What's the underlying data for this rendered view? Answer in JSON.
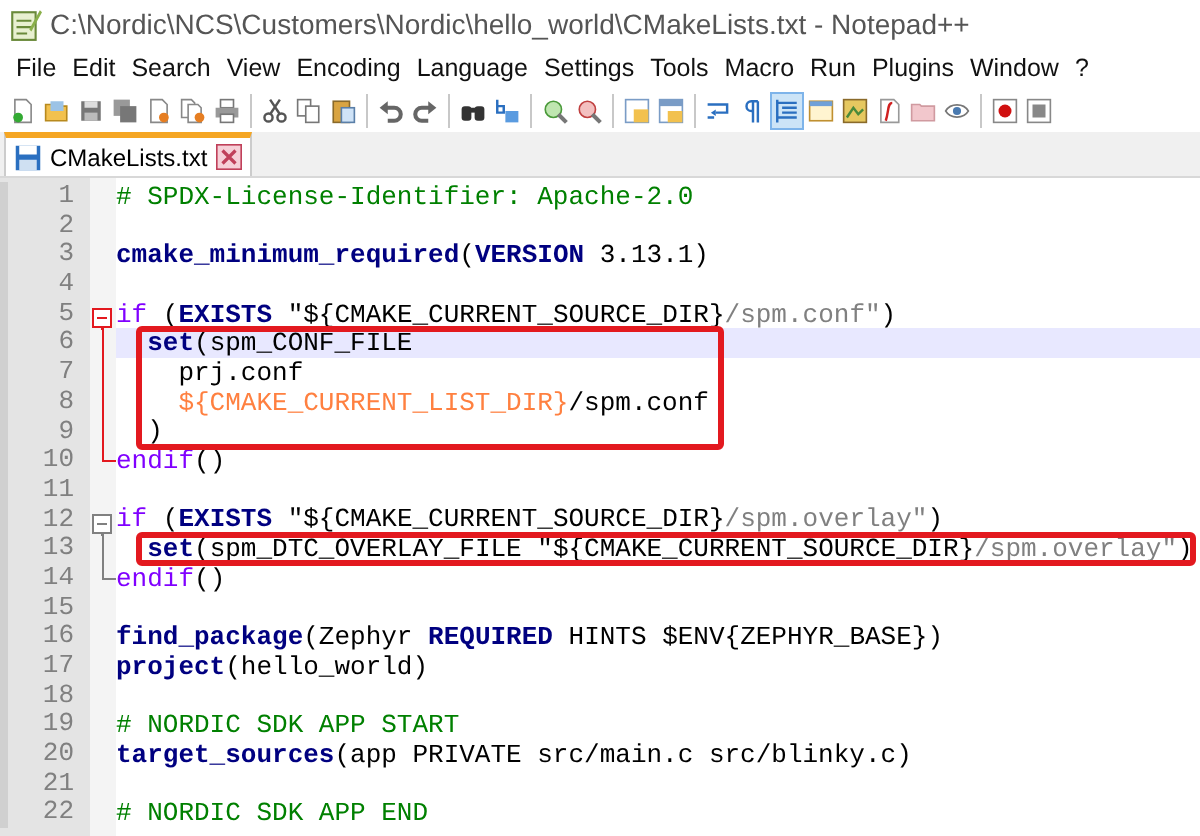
{
  "window": {
    "title": "C:\\Nordic\\NCS\\Customers\\Nordic\\hello_world\\CMakeLists.txt - Notepad++"
  },
  "menu": [
    "File",
    "Edit",
    "Search",
    "View",
    "Encoding",
    "Language",
    "Settings",
    "Tools",
    "Macro",
    "Run",
    "Plugins",
    "Window",
    "?"
  ],
  "toolbar": [
    {
      "kind": "new",
      "pressed": false
    },
    {
      "kind": "open",
      "pressed": false
    },
    {
      "kind": "save",
      "pressed": false
    },
    {
      "kind": "saveall",
      "pressed": false
    },
    {
      "kind": "close",
      "pressed": false
    },
    {
      "kind": "closeall",
      "pressed": false
    },
    {
      "kind": "print",
      "pressed": false
    },
    {
      "kind": "separator"
    },
    {
      "kind": "cut",
      "pressed": false
    },
    {
      "kind": "copy",
      "pressed": false
    },
    {
      "kind": "paste",
      "pressed": false
    },
    {
      "kind": "separator"
    },
    {
      "kind": "undo",
      "pressed": false
    },
    {
      "kind": "redo",
      "pressed": false
    },
    {
      "kind": "separator"
    },
    {
      "kind": "find",
      "pressed": false
    },
    {
      "kind": "replace",
      "pressed": false
    },
    {
      "kind": "separator"
    },
    {
      "kind": "zoomin",
      "pressed": false
    },
    {
      "kind": "zoomout",
      "pressed": false
    },
    {
      "kind": "separator"
    },
    {
      "kind": "syncv",
      "pressed": false
    },
    {
      "kind": "synch",
      "pressed": false
    },
    {
      "kind": "separator"
    },
    {
      "kind": "wrap",
      "pressed": false
    },
    {
      "kind": "allchars",
      "pressed": false
    },
    {
      "kind": "indent",
      "pressed": true
    },
    {
      "kind": "udl",
      "pressed": false
    },
    {
      "kind": "docmap",
      "pressed": false
    },
    {
      "kind": "funclist",
      "pressed": false
    },
    {
      "kind": "workspace",
      "pressed": false
    },
    {
      "kind": "monitor",
      "pressed": false
    },
    {
      "kind": "separator"
    },
    {
      "kind": "record",
      "pressed": false
    },
    {
      "kind": "stop",
      "pressed": false
    }
  ],
  "tabs": [
    {
      "label": "CMakeLists.txt",
      "selected": true,
      "modified": false
    }
  ],
  "lines": [
    {
      "number": "1",
      "current": false,
      "boxed": false,
      "tokens": [
        {
          "kind": "comment",
          "text": "# SPDX-License-Identifier: Apache-2.0"
        }
      ]
    },
    {
      "number": "2",
      "current": false,
      "boxed": false
    },
    {
      "number": "3",
      "current": false,
      "boxed": false,
      "tokens": [
        {
          "kind": "func",
          "text": "cmake_minimum_required"
        },
        {
          "kind": "plain",
          "text": "("
        },
        {
          "kind": "kw",
          "text": "VERSION"
        },
        {
          "kind": "plain",
          "text": " 3.13.1)"
        }
      ]
    },
    {
      "number": "4",
      "current": false,
      "boxed": false
    },
    {
      "number": "5",
      "current": false,
      "boxed": false,
      "fold_head": true,
      "fold_tail": false,
      "fold_active": true,
      "tokens": [
        {
          "kind": "ctrl",
          "text": "if"
        },
        {
          "kind": "plain",
          "text": " ("
        },
        {
          "kind": "kw",
          "text": "EXISTS"
        },
        {
          "kind": "plain",
          "text": " \"${CMAKE_CURRENT_SOURCE_DIR}"
        },
        {
          "kind": "str",
          "text": "/spm.conf\""
        },
        {
          "kind": "plain",
          "text": ")"
        }
      ]
    },
    {
      "number": "6",
      "current": true,
      "boxed": true,
      "fold_head": false,
      "fold_tail": false,
      "fold_active": true,
      "tokens": [
        {
          "kind": "func",
          "text": "  set"
        },
        {
          "kind": "plain",
          "text": "(spm_CONF_FILE"
        }
      ]
    },
    {
      "number": "7",
      "current": false,
      "boxed": true,
      "fold_head": false,
      "fold_tail": false,
      "fold_active": true,
      "tokens": [
        {
          "kind": "plain",
          "text": "    prj.conf"
        }
      ]
    },
    {
      "number": "8",
      "current": false,
      "boxed": true,
      "fold_head": false,
      "fold_tail": false,
      "fold_active": true,
      "tokens": [
        {
          "kind": "var",
          "text": "    ${CMAKE_CURRENT_LIST_DIR}"
        },
        {
          "kind": "plain",
          "text": "/spm.conf"
        }
      ]
    },
    {
      "number": "9",
      "current": false,
      "boxed": true,
      "fold_head": false,
      "fold_tail": false,
      "fold_active": true,
      "tokens": [
        {
          "kind": "plain",
          "text": "  )"
        }
      ]
    },
    {
      "number": "10",
      "current": false,
      "boxed": false,
      "fold_head": false,
      "fold_tail": true,
      "fold_active": true,
      "tokens": [
        {
          "kind": "ctrl",
          "text": "endif"
        },
        {
          "kind": "plain",
          "text": "()"
        }
      ]
    },
    {
      "number": "11",
      "current": false,
      "boxed": false
    },
    {
      "number": "12",
      "current": false,
      "boxed": false,
      "fold_head": true,
      "fold_tail": false,
      "fold_active": false,
      "tokens": [
        {
          "kind": "ctrl",
          "text": "if"
        },
        {
          "kind": "plain",
          "text": " ("
        },
        {
          "kind": "kw",
          "text": "EXISTS"
        },
        {
          "kind": "plain",
          "text": " \"${CMAKE_CURRENT_SOURCE_DIR}"
        },
        {
          "kind": "str",
          "text": "/spm.overlay\""
        },
        {
          "kind": "plain",
          "text": ")"
        }
      ]
    },
    {
      "number": "13",
      "current": false,
      "boxed": true,
      "fold_head": false,
      "fold_tail": false,
      "fold_active": false,
      "tokens": [
        {
          "kind": "func",
          "text": "  set"
        },
        {
          "kind": "plain",
          "text": "(spm_DTC_OVERLAY_FILE \"${CMAKE_CURRENT_SOURCE_DIR}"
        },
        {
          "kind": "str",
          "text": "/spm.overlay\""
        },
        {
          "kind": "plain",
          "text": ")"
        }
      ]
    },
    {
      "number": "14",
      "current": false,
      "boxed": false,
      "fold_head": false,
      "fold_tail": true,
      "fold_active": false,
      "tokens": [
        {
          "kind": "ctrl",
          "text": "endif"
        },
        {
          "kind": "plain",
          "text": "()"
        }
      ]
    },
    {
      "number": "15",
      "current": false,
      "boxed": false
    },
    {
      "number": "16",
      "current": false,
      "boxed": false,
      "tokens": [
        {
          "kind": "func",
          "text": "find_package"
        },
        {
          "kind": "plain",
          "text": "(Zephyr "
        },
        {
          "kind": "kw",
          "text": "REQUIRED"
        },
        {
          "kind": "plain",
          "text": " HINTS $ENV{ZEPHYR_BASE})"
        }
      ]
    },
    {
      "number": "17",
      "current": false,
      "boxed": false,
      "tokens": [
        {
          "kind": "func",
          "text": "project"
        },
        {
          "kind": "plain",
          "text": "(hello_world)"
        }
      ]
    },
    {
      "number": "18",
      "current": false,
      "boxed": false
    },
    {
      "number": "19",
      "current": false,
      "boxed": false,
      "tokens": [
        {
          "kind": "comment",
          "text": "# NORDIC SDK APP START"
        }
      ]
    },
    {
      "number": "20",
      "current": false,
      "boxed": false,
      "tokens": [
        {
          "kind": "func",
          "text": "target_sources"
        },
        {
          "kind": "plain",
          "text": "(app PRIVATE src/main.c src/blinky.c)"
        }
      ]
    },
    {
      "number": "21",
      "current": false,
      "boxed": false
    },
    {
      "number": "22",
      "current": false,
      "boxed": false,
      "tokens": [
        {
          "kind": "comment",
          "text": "# NORDIC SDK APP END"
        }
      ]
    }
  ]
}
